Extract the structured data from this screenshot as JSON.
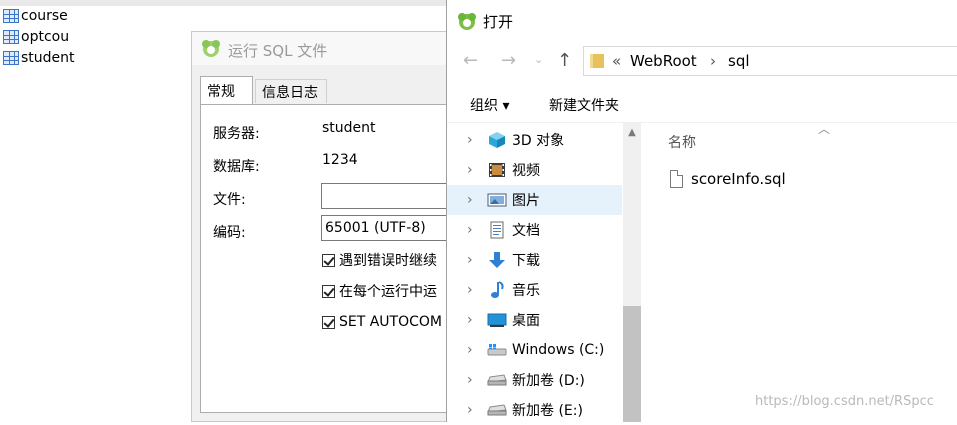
{
  "background": {
    "tables": [
      "course",
      "optcou",
      "student"
    ]
  },
  "run_dialog": {
    "title": "运行 SQL 文件",
    "tabs": [
      "常规",
      "信息日志"
    ],
    "server_label": "服务器:",
    "server_value": "student",
    "database_label": "数据库:",
    "database_value": "1234",
    "file_label": "文件:",
    "file_value": "",
    "encoding_label": "编码:",
    "encoding_value": "65001 (UTF-8)",
    "options": [
      {
        "label": "遇到错误时继续",
        "checked": true
      },
      {
        "label": "在每个运行中运",
        "checked": true
      },
      {
        "label": "SET AUTOCOM",
        "checked": true
      }
    ]
  },
  "open_dialog": {
    "title": "打开",
    "breadcrumb": {
      "prefix": "«",
      "parts": [
        "WebRoot",
        "sql"
      ],
      "separator": "›"
    },
    "commands": {
      "organize": "组织 ▾",
      "new_folder": "新建文件夹"
    },
    "nav_items": [
      {
        "label": "3D 对象",
        "icon": "cube-icon"
      },
      {
        "label": "视频",
        "icon": "video-icon"
      },
      {
        "label": "图片",
        "icon": "picture-icon",
        "selected": true
      },
      {
        "label": "文档",
        "icon": "document-icon"
      },
      {
        "label": "下载",
        "icon": "download-icon"
      },
      {
        "label": "音乐",
        "icon": "music-icon"
      },
      {
        "label": "桌面",
        "icon": "desktop-icon"
      },
      {
        "label": "Windows (C:)",
        "icon": "windows-drive-icon"
      },
      {
        "label": "新加卷 (D:)",
        "icon": "drive-icon"
      },
      {
        "label": "新加卷 (E:)",
        "icon": "drive-icon"
      }
    ],
    "column_name": "名称",
    "files": [
      "scoreInfo.sql"
    ]
  },
  "watermark": "https://blog.csdn.net/RSpcc"
}
